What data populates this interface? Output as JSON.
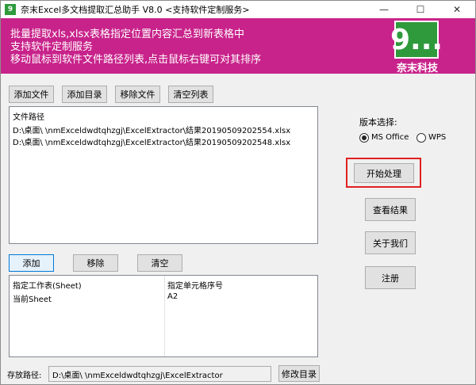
{
  "window": {
    "title": "奈末Excel多文档提取汇总助手 V8.0 <支持软件定制服务>",
    "controls": {
      "minimize": "—",
      "maximize": "☐",
      "close": "✕"
    }
  },
  "banner": {
    "line1": "批量提取xls,xlsx表格指定位置内容汇总到新表格中",
    "line2": "支持软件定制服务",
    "line3": "移动鼠标到软件文件路径列表,点击鼠标右键可对其排序",
    "logo_mark": "9...",
    "logo_text": "奈末科技"
  },
  "file_toolbar": {
    "add_file": "添加文件",
    "add_dir": "添加目录",
    "remove_file": "移除文件",
    "clear_list": "清空列表"
  },
  "file_list": {
    "header": "文件路径",
    "rows": [
      "D:\\桌面\\          \\nmExceldwdtqhzgj\\ExcelExtractor\\结果20190509202554.xlsx",
      "D:\\桌面\\          \\nmExceldwdtqhzgj\\ExcelExtractor\\结果20190509202548.xlsx"
    ]
  },
  "version": {
    "label": "版本选择:",
    "options": [
      "MS Office",
      "WPS"
    ],
    "selected": "MS Office"
  },
  "actions": {
    "start": "开始处理",
    "view_result": "查看结果",
    "about": "关于我们",
    "register": "注册"
  },
  "sheet_toolbar": {
    "add": "添加",
    "remove": "移除",
    "clear": "清空"
  },
  "sheet_table": {
    "columns": [
      "指定工作表(Sheet)",
      "指定单元格序号"
    ],
    "rows": [
      [
        "当前Sheet",
        "A2"
      ]
    ]
  },
  "output": {
    "label": "存放路径:",
    "path": "D:\\桌面\\          \\nmExceldwdtqhzgj\\ExcelExtractor",
    "change_dir": "修改目录"
  }
}
